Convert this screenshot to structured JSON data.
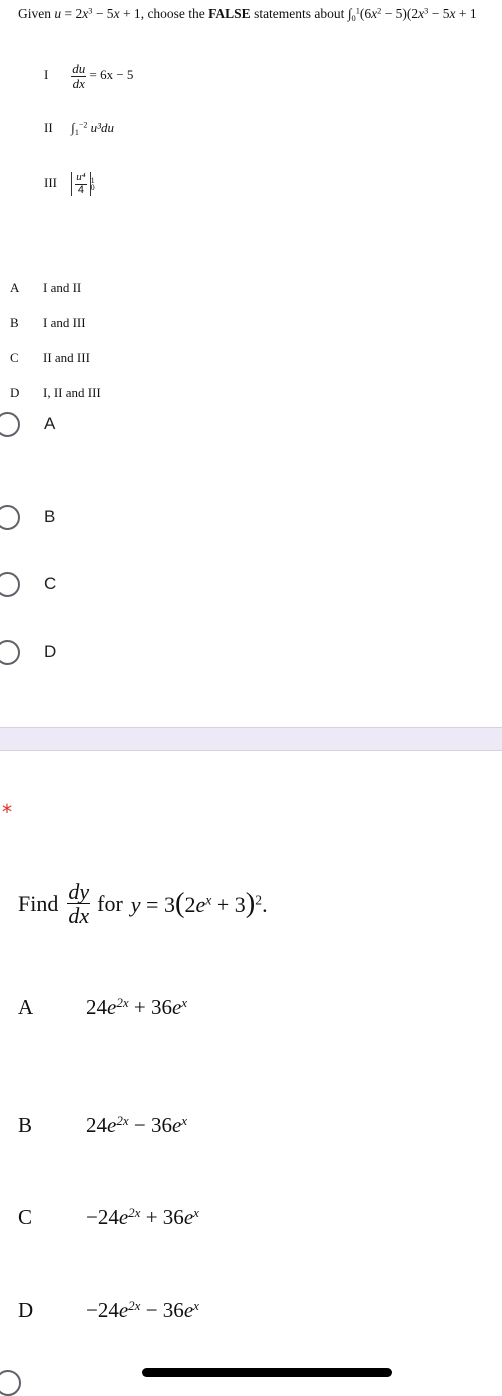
{
  "question1": {
    "stem": {
      "prefix": "Given ",
      "u_def": "u = 2x³ − 5x + 1",
      "middle": ", choose the ",
      "emphasis": "FALSE",
      "suffix": " statements about ",
      "integral": "∫₀¹ (6x² − 5)(2x³ − 5x + 1"
    },
    "statements": [
      {
        "numeral": "I",
        "expr_num": "du",
        "expr_den": "dx",
        "expr_rest": "= 6x − 5"
      },
      {
        "numeral": "II",
        "integral_upper": "−2",
        "integral_lower": "1",
        "integrand": "u³du"
      },
      {
        "numeral": "III",
        "frac_num": "u⁴",
        "frac_den": "4",
        "upper": "1",
        "lower": "0"
      }
    ],
    "choices": [
      {
        "letter": "A",
        "text": "I and II"
      },
      {
        "letter": "B",
        "text": "I and III"
      },
      {
        "letter": "C",
        "text": "II and III"
      },
      {
        "letter": "D",
        "text": "I, II and III"
      }
    ],
    "radio_options": [
      {
        "label": "A",
        "selected": false
      },
      {
        "label": "B",
        "selected": false
      },
      {
        "label": "C",
        "selected": false
      },
      {
        "label": "D",
        "selected": false
      }
    ]
  },
  "question2": {
    "required_marker": "*",
    "stem": {
      "find": "Find",
      "deriv_num": "dy",
      "deriv_den": "dx",
      "for": "for",
      "equation": "y = 3(2eˣ + 3)²."
    },
    "choices": [
      {
        "letter": "A",
        "text": "24e²ˣ + 36eˣ"
      },
      {
        "letter": "B",
        "text": "24e²ˣ − 36eˣ"
      },
      {
        "letter": "C",
        "text": "−24e²ˣ + 36eˣ"
      },
      {
        "letter": "D",
        "text": "−24e²ˣ − 36eˣ"
      }
    ]
  },
  "colors": {
    "section_band": "#ede9f7",
    "required": "#d93025",
    "radio_border": "#5f6368"
  }
}
